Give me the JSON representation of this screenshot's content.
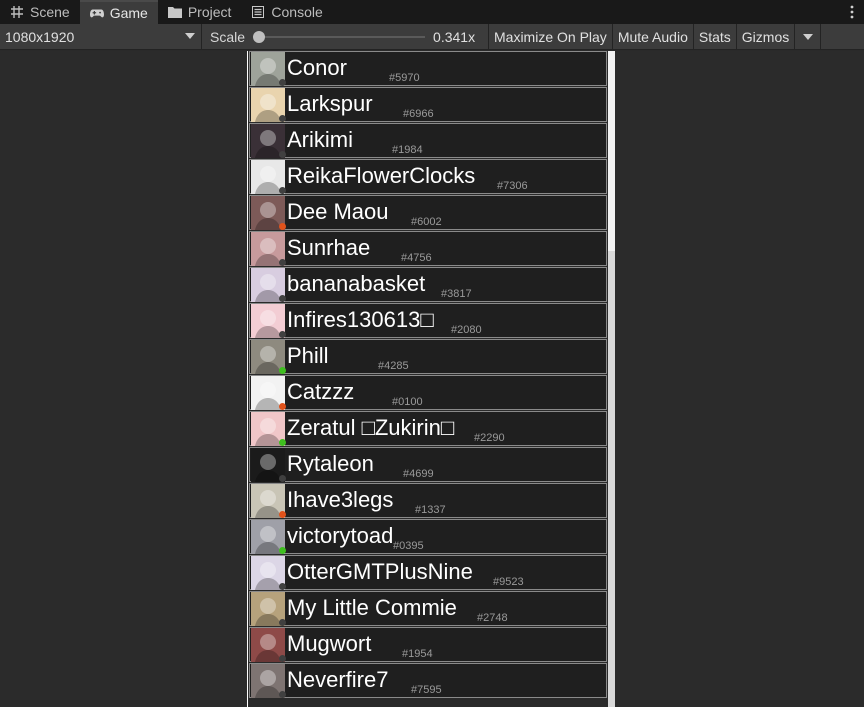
{
  "tabs": [
    {
      "label": "Scene",
      "icon": "grid-icon"
    },
    {
      "label": "Game",
      "icon": "gamepad-icon"
    },
    {
      "label": "Project",
      "icon": "folder-icon"
    },
    {
      "label": "Console",
      "icon": "console-icon"
    }
  ],
  "toolbar": {
    "resolution": "1080x1920",
    "scale_label": "Scale",
    "scale_value": "0.341x",
    "maximize_on_play": "Maximize On Play",
    "mute_audio": "Mute Audio",
    "stats": "Stats",
    "gizmos": "Gizmos"
  },
  "colors": {
    "online": "#3fbf1f",
    "idle": "#e0821b",
    "dnd": "#e0521b",
    "offline": "#404040"
  },
  "members": [
    {
      "name": "Conor",
      "discriminator": "#5970",
      "status": "offline",
      "avatar": "#9ea39a"
    },
    {
      "name": "Larkspur",
      "discriminator": "#6966",
      "status": "offline",
      "avatar": "#e9d4ae"
    },
    {
      "name": "Arikimi",
      "discriminator": "#1984",
      "status": "offline",
      "avatar": "#3a3037"
    },
    {
      "name": "ReikaFlowerClocks",
      "discriminator": "#7306",
      "status": "offline",
      "avatar": "#e8e8e8"
    },
    {
      "name": "Dee Maou",
      "discriminator": "#6002",
      "status": "dnd",
      "avatar": "#7d5a58"
    },
    {
      "name": "Sunrhae",
      "discriminator": "#4756",
      "status": "offline",
      "avatar": "#c79a9c"
    },
    {
      "name": "bananabasket",
      "discriminator": "#3817",
      "status": "offline",
      "avatar": "#d8cde0"
    },
    {
      "name": "Infires130613□",
      "discriminator": "#2080",
      "status": "offline",
      "avatar": "#f3cdd4"
    },
    {
      "name": "Phill",
      "discriminator": "#4285",
      "status": "online",
      "avatar": "#8e8a7f"
    },
    {
      "name": "Catzzz",
      "discriminator": "#0100",
      "status": "dnd",
      "avatar": "#f2f2f2"
    },
    {
      "name": "Zeratul □Zukirin□",
      "discriminator": "#2290",
      "status": "online",
      "avatar": "#f0c6c8"
    },
    {
      "name": "Rytaleon",
      "discriminator": "#4699",
      "status": "offline",
      "avatar": "#1b1b1b"
    },
    {
      "name": "Ihave3legs",
      "discriminator": "#1337",
      "status": "dnd",
      "avatar": "#c9c5b6"
    },
    {
      "name": "victorytoad",
      "discriminator": "#0395",
      "status": "online",
      "avatar": "#9fa0a8"
    },
    {
      "name": "OtterGMTPlusNine",
      "discriminator": "#9523",
      "status": "offline",
      "avatar": "#dcd6e6"
    },
    {
      "name": "My Little Commie",
      "discriminator": "#2748",
      "status": "offline",
      "avatar": "#b6a27c"
    },
    {
      "name": "Mugwort",
      "discriminator": "#1954",
      "status": "offline",
      "avatar": "#8e4a48"
    },
    {
      "name": "Neverfire7",
      "discriminator": "#7595",
      "status": "offline",
      "avatar": "#7e7472"
    }
  ]
}
